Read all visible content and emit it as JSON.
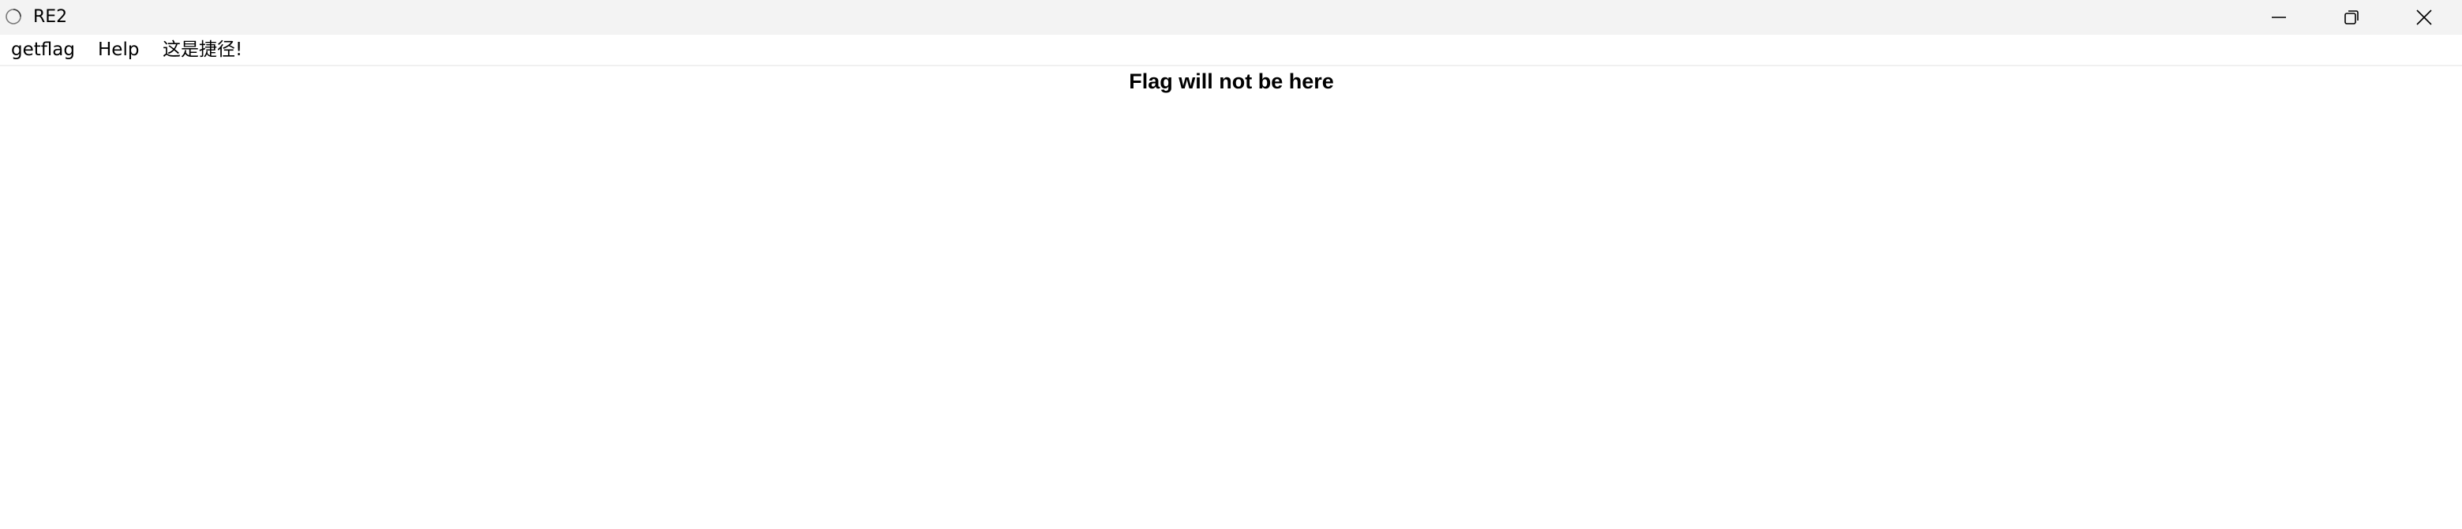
{
  "window": {
    "title": "RE2",
    "app_icon": "circle-outline-icon",
    "controls": {
      "minimize": "minimize-icon",
      "maximize": "restore-icon",
      "close": "close-icon"
    }
  },
  "menu": {
    "items": [
      {
        "label": "getflag"
      },
      {
        "label": "Help"
      },
      {
        "label": "这是捷径!"
      }
    ]
  },
  "content": {
    "label": "Flag will not be here"
  }
}
